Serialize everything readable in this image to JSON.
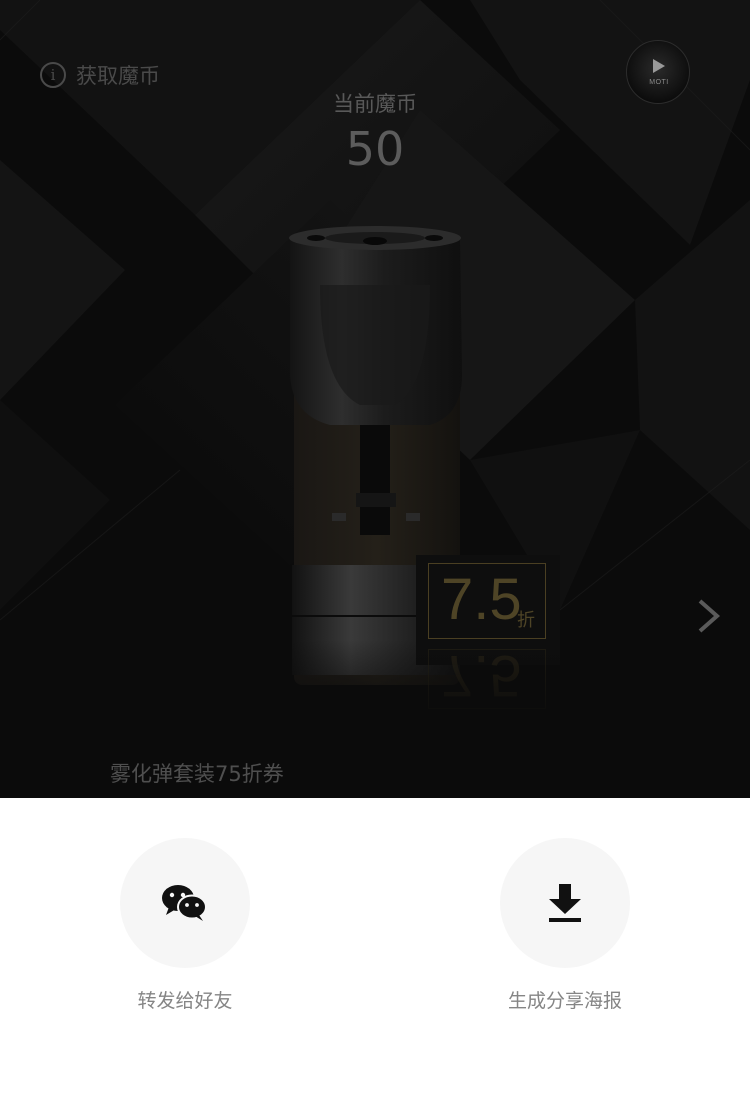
{
  "header": {
    "get_coins_label": "获取魔币",
    "info_icon": "info-icon",
    "brand_badge_text": "MOTI"
  },
  "coins": {
    "label": "当前魔币",
    "value": "50"
  },
  "coupon": {
    "discount_value": "7.5",
    "discount_unit": "折",
    "title": "雾化弹套装75折券",
    "accent_color": "#4e4426"
  },
  "share": {
    "options": [
      {
        "label": "转发给好友",
        "icon": "wechat-icon"
      },
      {
        "label": "生成分享海报",
        "icon": "download-icon"
      }
    ]
  }
}
